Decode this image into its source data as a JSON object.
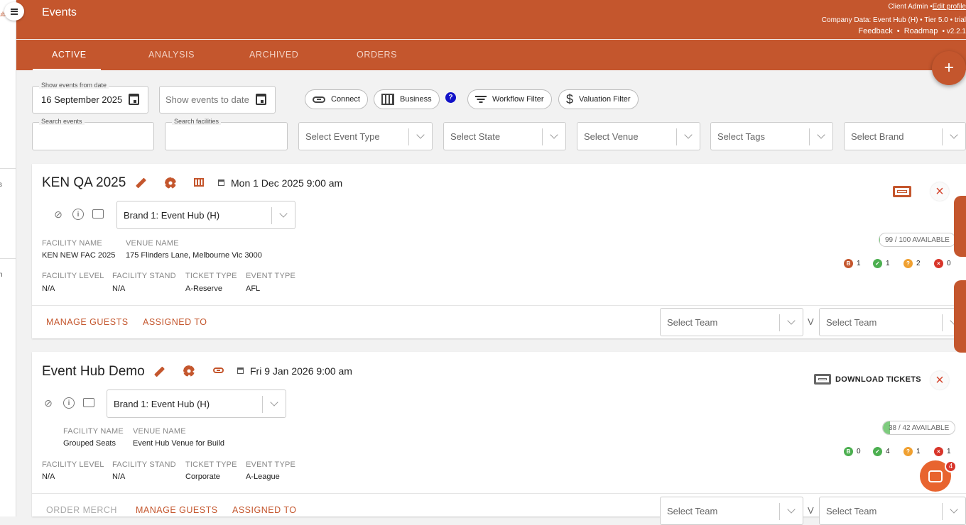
{
  "sidebar": {
    "brand_fragment": "ub",
    "frag_s": "s",
    "frag_n": "n"
  },
  "header": {
    "title": "Events",
    "role": "Client Admin •",
    "edit_profile": "Edit profile",
    "company_line": "Company Data: Event Hub (H) • Tier 5.0 • trial",
    "feedback": "Feedback",
    "roadmap": "Roadmap",
    "sep": "•",
    "version": "• v2.2.1"
  },
  "tabs": [
    "ACTIVE",
    "ANALYSIS",
    "ARCHIVED",
    "ORDERS"
  ],
  "filters": {
    "from_label": "Show events from date",
    "from_value": "16 September 2025",
    "to_placeholder": "Show events to date",
    "connect": "Connect",
    "business": "Business",
    "help": "?",
    "workflow": "Workflow Filter",
    "valuation": "Valuation Filter",
    "search_events_label": "Search events",
    "search_facilities_label": "Search facilities",
    "event_type": "Select Event Type",
    "state": "Select State",
    "venue": "Select Venue",
    "tags": "Select Tags",
    "brand": "Select Brand"
  },
  "labels": {
    "facility_name": "FACILITY NAME",
    "venue_name": "VENUE NAME",
    "facility_level": "FACILITY LEVEL",
    "facility_stand": "FACILITY STAND",
    "ticket_type": "TICKET TYPE",
    "event_type": "EVENT TYPE",
    "order_merch": "ORDER MERCH",
    "manage_guests": "MANAGE GUESTS",
    "assigned_to": "ASSIGNED TO",
    "select_team": "Select Team",
    "or": "V",
    "download_tickets": "DOWNLOAD TICKETS",
    "close": "×"
  },
  "events": [
    {
      "title": "KEN QA 2025",
      "date": "Mon 1 Dec 2025 9:00 am",
      "brand": "Brand 1: Event Hub (H)",
      "facility_name": "KEN NEW FAC 2025",
      "venue_name": "175 Flinders Lane, Melbourne Vic 3000",
      "facility_level": "N/A",
      "facility_stand": "N/A",
      "ticket_type": "A-Reserve",
      "event_type": "AFL",
      "available": "99 / 100 AVAILABLE",
      "fill_fraction": 0.01,
      "stats": {
        "b": "1",
        "ok": "1",
        "q": "2",
        "x": "0"
      }
    },
    {
      "title": "Event Hub Demo",
      "date": "Fri 9 Jan 2026 9:00 am",
      "brand": "Brand 1: Event Hub (H)",
      "facility_name": "Grouped Seats",
      "venue_name": "Event Hub Venue for Build",
      "facility_level": "N/A",
      "facility_stand": "N/A",
      "ticket_type": "Corporate",
      "event_type": "A-League",
      "available": "38 / 42 AVAILABLE",
      "fill_fraction": 0.095,
      "stats": {
        "b": "0",
        "ok": "4",
        "q": "1",
        "x": "1"
      }
    }
  ],
  "stat_glyphs": {
    "b": "B",
    "ok": "✓",
    "q": "?",
    "x": "×"
  },
  "colors": {
    "brand": "#c4562d",
    "green": "#4caf50",
    "orange": "#f0a030",
    "red": "#d8352a",
    "b_icon": "#c4562d"
  },
  "fab": "+",
  "chat_badge": "4"
}
